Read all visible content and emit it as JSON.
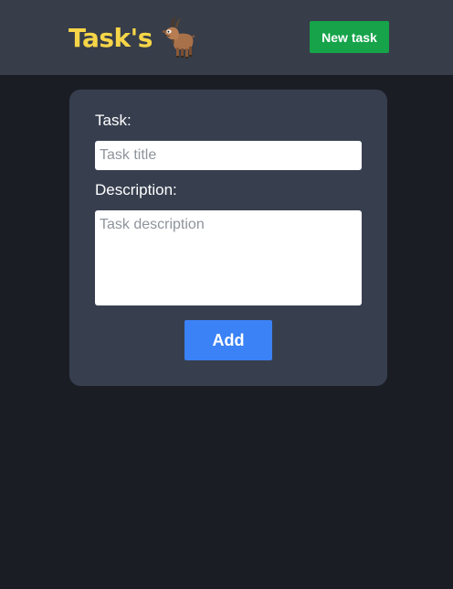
{
  "header": {
    "title": "Task's",
    "logo_icon": "goat-icon",
    "new_task_label": "New task"
  },
  "form": {
    "task_label": "Task:",
    "task_placeholder": "Task title",
    "task_value": "",
    "description_label": "Description:",
    "description_placeholder": "Task description",
    "description_value": "",
    "add_label": "Add"
  },
  "colors": {
    "background": "#1b1d25",
    "header": "#373d49",
    "card": "#373f4f",
    "brand": "#f6d548",
    "new_task_button": "#16a34a",
    "add_button": "#3b82f6"
  }
}
